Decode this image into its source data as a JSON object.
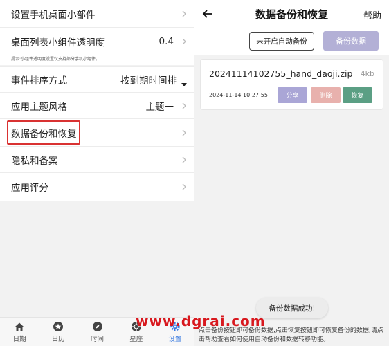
{
  "settings": {
    "widget": {
      "label": "设置手机桌面小部件"
    },
    "transparency": {
      "label": "桌面列表小组件透明度",
      "value": "0.4"
    },
    "hint": "提示:小组件透明度设置仅支持部分手机小组件。",
    "sort": {
      "label": "事件排序方式",
      "value": "按到期时间排"
    },
    "theme": {
      "label": "应用主题风格",
      "value": "主题一"
    },
    "backup": {
      "label": "数据备份和恢复"
    },
    "privacy": {
      "label": "隐私和备案"
    },
    "rating": {
      "label": "应用评分"
    }
  },
  "nav": {
    "items": [
      {
        "label": "日期",
        "icon": "home-icon"
      },
      {
        "label": "日历",
        "icon": "star-icon"
      },
      {
        "label": "时间",
        "icon": "compass-icon"
      },
      {
        "label": "星座",
        "icon": "aperture-icon"
      },
      {
        "label": "设置",
        "icon": "gear-icon",
        "active": true
      }
    ]
  },
  "backup_page": {
    "title": "数据备份和恢复",
    "help": "帮助",
    "auto_backup_button": "未开启自动备份",
    "backup_button": "备份数据",
    "file": {
      "name": "20241114102755_hand_daoji.zip",
      "size": "4kb",
      "time": "2024-11-14 10:27:55",
      "share": "分享",
      "delete": "删除",
      "restore": "恢复"
    },
    "toast": "备份数据成功!",
    "footnote": "点击备份按钮即可备份数据,点击恢复按钮即可恢复备份的数据,请点击帮助查看如何使用自动备份和数据转移功能。"
  },
  "watermark": "www.dgrai.com",
  "colors": {
    "accent": "#3a7be0",
    "highlight": "#d93232",
    "backup_button": "#b3b0d6",
    "share": "#aaa6d6",
    "delete": "#e8b1ad",
    "restore": "#5b9f84",
    "watermark": "#d8181e"
  }
}
